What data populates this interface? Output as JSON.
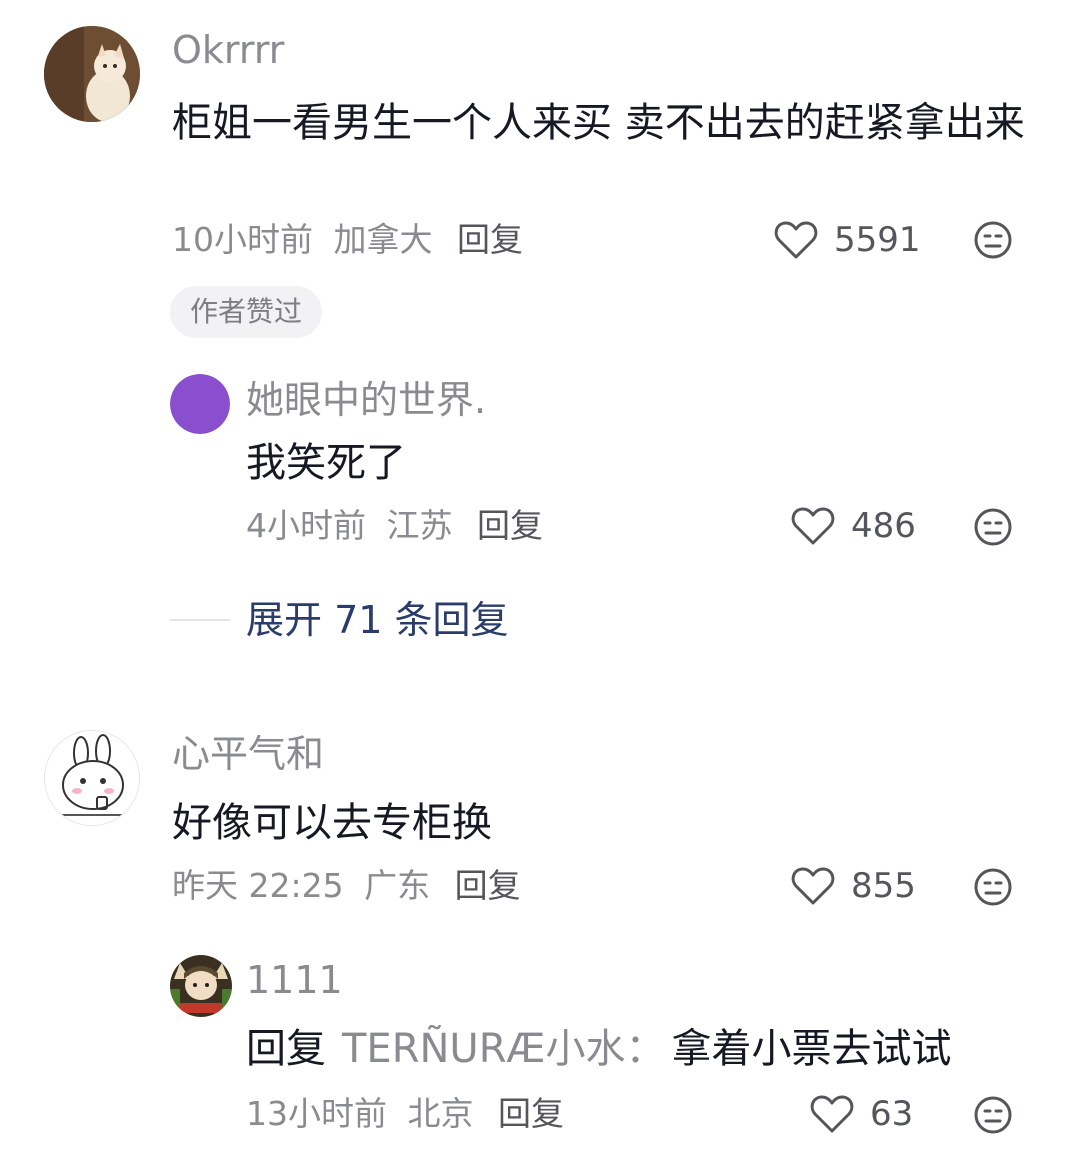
{
  "comments": [
    {
      "username": "Okrrrr",
      "text": "柜姐一看男生一个人来买 卖不出去的赶紧拿出来",
      "time": "10小时前",
      "location": "加拿大",
      "reply_label": "回复",
      "likes": "5591",
      "badge": "作者赞过",
      "avatar_icon": "cat-avatar-icon",
      "replies": [
        {
          "username": "她眼中的世界.",
          "text": "我笑死了",
          "time": "4小时前",
          "location": "江苏",
          "reply_label": "回复",
          "likes": "486",
          "avatar_color": "#8a4fcf"
        }
      ],
      "expand_label": "展开 71 条回复"
    },
    {
      "username": "心平气和",
      "text": "好像可以去专柜换",
      "time": "昨天 22:25",
      "location": "广东",
      "reply_label": "回复",
      "likes": "855",
      "avatar_icon": "bunny-avatar-icon",
      "replies": [
        {
          "username": "1111",
          "reply_prefix": "回复",
          "reply_to": "TERÑURÆ小水：",
          "text": "拿着小票去试试",
          "time": "13小时前",
          "location": "北京",
          "reply_label": "回复",
          "likes": "63",
          "avatar_icon": "anime-avatar-icon"
        }
      ]
    }
  ],
  "colors": {
    "muted": "#8a8b91",
    "link": "#2a3d6a",
    "text": "#161823"
  }
}
